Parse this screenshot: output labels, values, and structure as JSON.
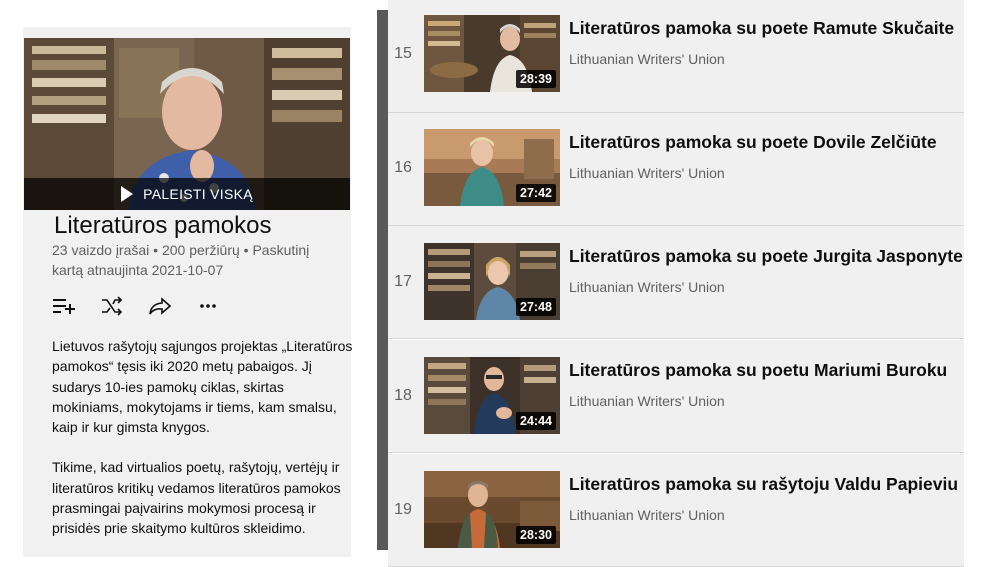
{
  "playlist": {
    "play_all_label": "PALEISTI VISKĄ",
    "title": "Literatūros pamokos",
    "meta": "23 vaizdo įrašai • 200 peržiūrų • Paskutinį kartą atnaujinta 2021-10-07",
    "actions": [
      {
        "icon": "save-to-library-icon"
      },
      {
        "icon": "shuffle-icon"
      },
      {
        "icon": "share-icon"
      },
      {
        "icon": "more-options-icon"
      }
    ],
    "description": [
      "Lietuvos rašytojų sąjungos projektas „Literatūros pamokos“ tęsis iki 2020 metų pabaigos. Jį sudarys 10-ies pamokų ciklas, skirtas mokiniams, mokytojams ir tiems, kam smalsu, kaip ir kur gimsta knygos.",
      "Tikime, kad virtualios poetų, rašytojų, vertėjų ir literatūros kritikų vedamos literatūros pamokos prasmingai paįvairins mokymosi procesą ir prisidės prie skaitymo kultūros skleidimo."
    ]
  },
  "videos": [
    {
      "index": "15",
      "title": "Literatūros pamoka su poete Ramute Skučaite",
      "channel": "Lithuanian Writers' Union",
      "duration": "28:39"
    },
    {
      "index": "16",
      "title": "Literatūros pamoka su poete Dovile Zelčiūte",
      "channel": "Lithuanian Writers' Union",
      "duration": "27:42"
    },
    {
      "index": "17",
      "title": "Literatūros pamoka su poete Jurgita Jasponyte",
      "channel": "Lithuanian Writers' Union",
      "duration": "27:48"
    },
    {
      "index": "18",
      "title": "Literatūros pamoka su poetu Mariumi Buroku",
      "channel": "Lithuanian Writers' Union",
      "duration": "24:44"
    },
    {
      "index": "19",
      "title": "Literatūros pamoka su rašytoju Valdu Papieviu",
      "channel": "Lithuanian Writers' Union",
      "duration": "28:30"
    }
  ]
}
